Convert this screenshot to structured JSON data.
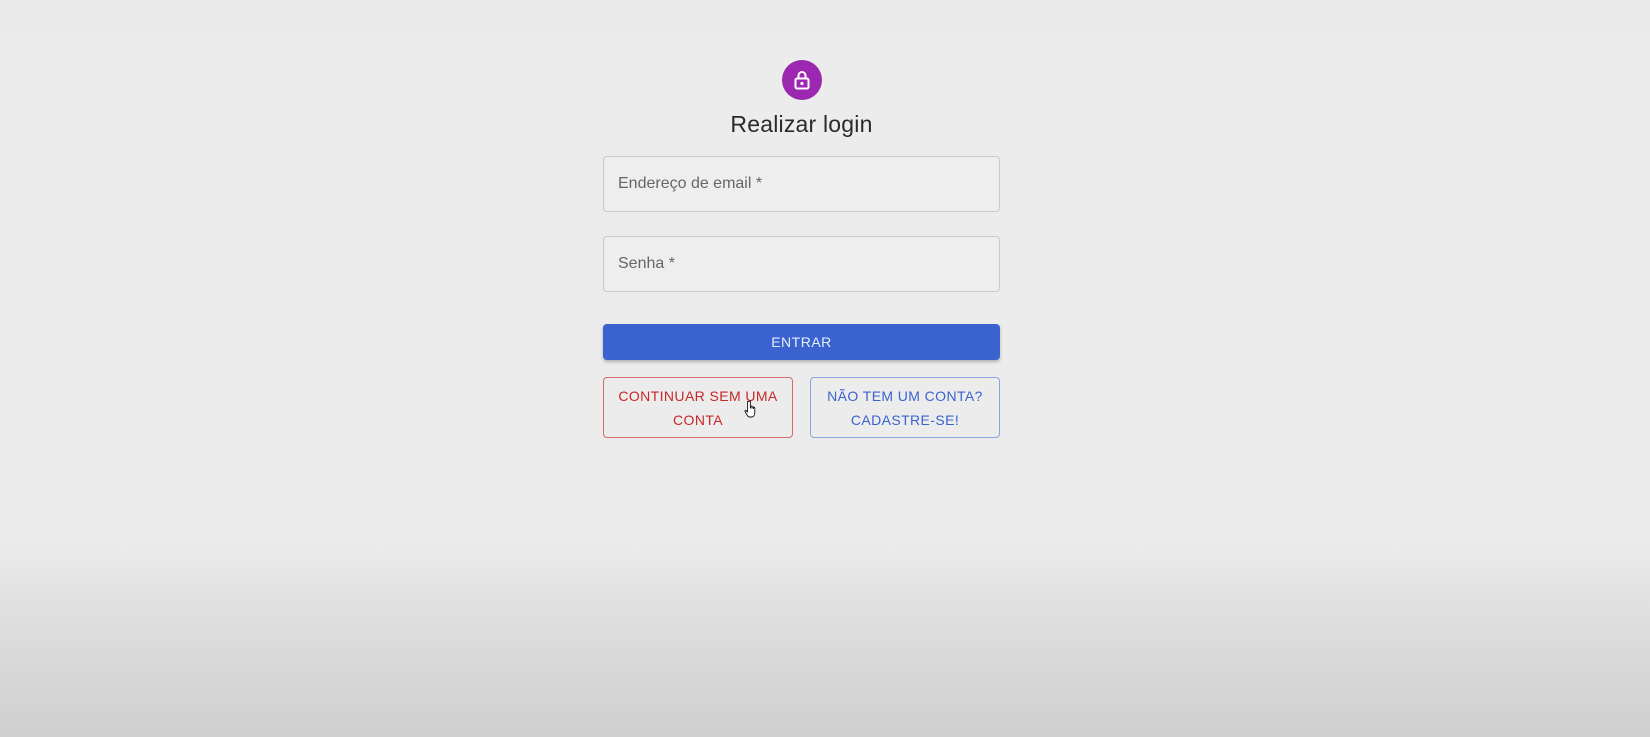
{
  "page": {
    "title": "Realizar login",
    "lock_icon": "lock-icon",
    "accent_color": "#9c27b0"
  },
  "form": {
    "email": {
      "placeholder": "Endereço de email *",
      "value": ""
    },
    "password": {
      "placeholder": "Senha *",
      "value": ""
    },
    "submit_label": "ENTRAR",
    "submit_color": "#3b63cf"
  },
  "actions": {
    "guest_label": "CONTINUAR SEM UMA CONTA",
    "guest_color": "#c62828",
    "register_label": "NÃO TEM UM CONTA? CADASTRE-SE!",
    "register_color": "#3b63cf"
  },
  "cursor": {
    "icon": "hand-pointer-icon"
  }
}
